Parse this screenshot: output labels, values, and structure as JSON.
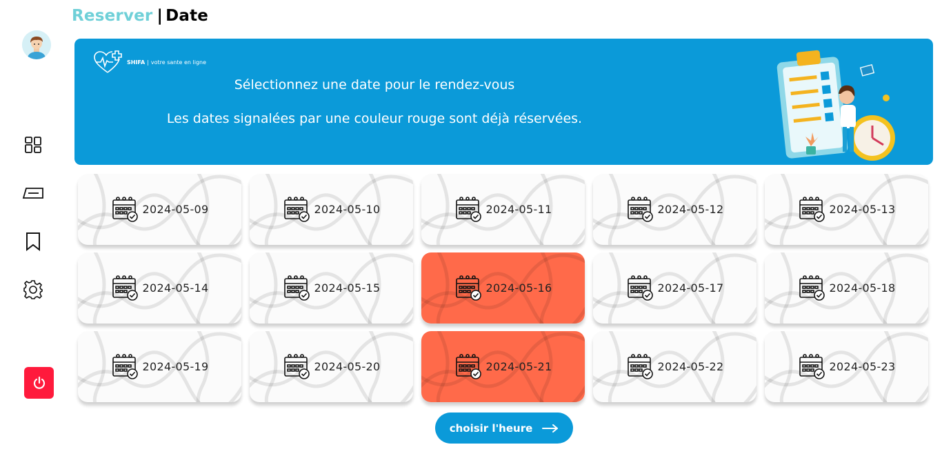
{
  "page": {
    "title_part1": "Reserver",
    "title_separator": "|",
    "title_part2": "Date"
  },
  "sidebar": {
    "items": [
      {
        "name": "dashboard-icon"
      },
      {
        "name": "ticket-icon"
      },
      {
        "name": "bookmark-icon"
      },
      {
        "name": "gear-icon"
      }
    ],
    "logout_icon": "power-icon"
  },
  "banner": {
    "brand_name": "SHIFA",
    "brand_separator": "|",
    "brand_tagline": "votre sante en ligne",
    "line1": "Sélectionnez une date pour le rendez-vous",
    "line2": "Les dates signalées par une couleur rouge sont déjà réservées."
  },
  "dates": [
    {
      "label": "2024-05-09",
      "booked": false
    },
    {
      "label": "2024-05-10",
      "booked": false
    },
    {
      "label": "2024-05-11",
      "booked": false
    },
    {
      "label": "2024-05-12",
      "booked": false
    },
    {
      "label": "2024-05-13",
      "booked": false
    },
    {
      "label": "2024-05-14",
      "booked": false
    },
    {
      "label": "2024-05-15",
      "booked": false
    },
    {
      "label": "2024-05-16",
      "booked": true
    },
    {
      "label": "2024-05-17",
      "booked": false
    },
    {
      "label": "2024-05-18",
      "booked": false
    },
    {
      "label": "2024-05-19",
      "booked": false
    },
    {
      "label": "2024-05-20",
      "booked": false
    },
    {
      "label": "2024-05-21",
      "booked": true
    },
    {
      "label": "2024-05-22",
      "booked": false
    },
    {
      "label": "2024-05-23",
      "booked": false
    }
  ],
  "cta": {
    "label": "choisir l'heure",
    "icon": "arrow-right-icon"
  },
  "colors": {
    "accent": "#0b9ad9",
    "title_accent": "#6fd0d8",
    "booked": "#ff6a4a",
    "logout": "#ff1a3c"
  }
}
